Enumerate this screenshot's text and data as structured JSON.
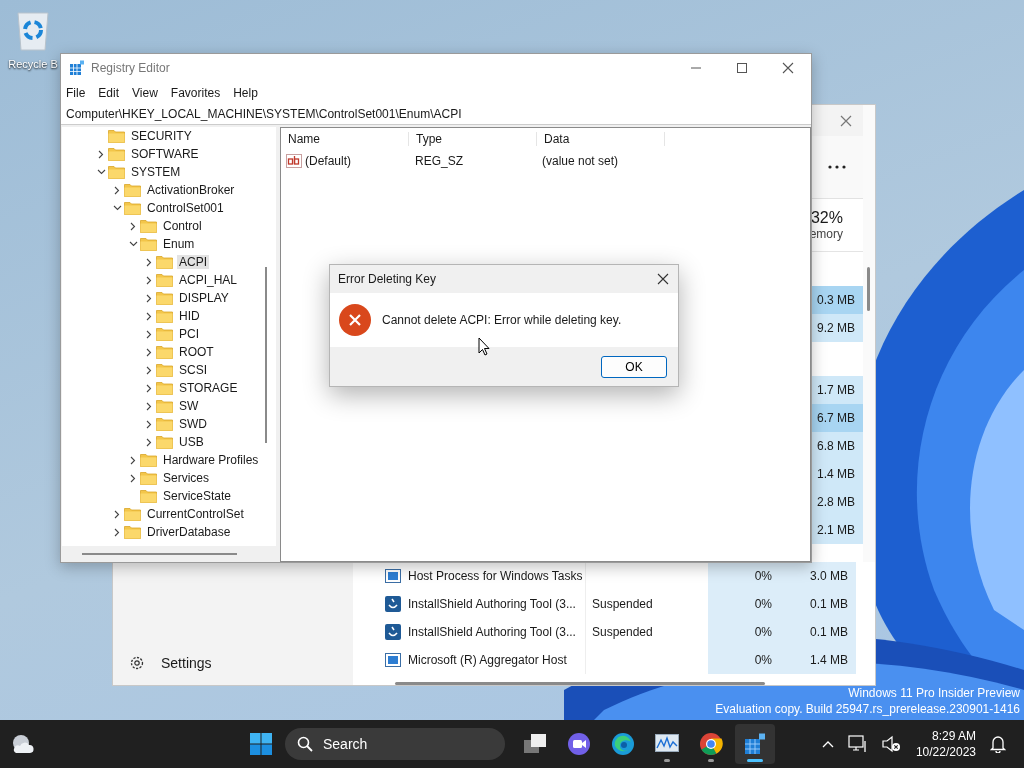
{
  "desktop": {
    "icons": [
      {
        "label": "Recycle B"
      }
    ],
    "watermark": [
      "Windows 11 Pro Insider Preview",
      "Evaluation copy. Build 25947.rs_prerelease.230901-1416"
    ]
  },
  "task_manager": {
    "memory_percent": "32%",
    "memory_label": "emory",
    "memory_rows": [
      {
        "kind": "group"
      },
      {
        "kind": "process",
        "memory": "0.3 MB",
        "color": "#a8d5f2"
      },
      {
        "kind": "process",
        "memory": "9.2 MB",
        "color": "#cfe8f8"
      },
      {
        "kind": "group"
      },
      {
        "kind": "process",
        "memory": "1.7 MB",
        "color": "#cfe8f8"
      },
      {
        "kind": "process",
        "memory": "6.7 MB",
        "color": "#a8d5f2"
      },
      {
        "kind": "process",
        "memory": "6.8 MB",
        "color": "#cfe8f8"
      },
      {
        "kind": "process",
        "memory": "1.4 MB",
        "color": "#cfe8f8"
      },
      {
        "kind": "process",
        "memory": "2.8 MB",
        "color": "#cfe8f8"
      },
      {
        "kind": "process",
        "memory": "2.1 MB",
        "color": "#cfe8f8"
      }
    ],
    "processes": [
      {
        "kind": "window",
        "name": "Host Process for Windows Tasks",
        "cpu": "0%",
        "memory": "3.0 MB"
      },
      {
        "kind": "installer",
        "name": "InstallShield Authoring Tool (3...",
        "status": "Suspended",
        "cpu": "0%",
        "memory": "0.1 MB"
      },
      {
        "kind": "installer",
        "name": "InstallShield Authoring Tool (3...",
        "status": "Suspended",
        "cpu": "0%",
        "memory": "0.1 MB"
      },
      {
        "kind": "window",
        "name": "Microsoft (R) Aggregator Host",
        "cpu": "0%",
        "memory": "1.4 MB"
      }
    ],
    "settings": "Settings"
  },
  "registry": {
    "title": "Registry Editor",
    "menu": [
      "File",
      "Edit",
      "View",
      "Favorites",
      "Help"
    ],
    "address": "Computer\\HKEY_LOCAL_MACHINE\\SYSTEM\\ControlSet001\\Enum\\ACPI",
    "tree": [
      {
        "label": "SECURITY",
        "expandable": false,
        "selected": false
      },
      {
        "label": "SOFTWARE",
        "expandable": true,
        "expanded": false,
        "selected": false
      },
      {
        "label": "SYSTEM",
        "expandable": true,
        "expanded": true,
        "selected": false,
        "children": [
          {
            "label": "ActivationBroker",
            "expandable": true,
            "expanded": false,
            "selected": false
          },
          {
            "label": "ControlSet001",
            "expandable": true,
            "expanded": true,
            "selected": false,
            "children": [
              {
                "label": "Control",
                "expandable": true,
                "expanded": false,
                "selected": false
              },
              {
                "label": "Enum",
                "expandable": true,
                "expanded": true,
                "selected": false,
                "children": [
                  {
                    "label": "ACPI",
                    "expandable": true,
                    "expanded": false,
                    "selected": true
                  },
                  {
                    "label": "ACPI_HAL",
                    "expandable": true,
                    "expanded": false,
                    "selected": false
                  },
                  {
                    "label": "DISPLAY",
                    "expandable": true,
                    "expanded": false,
                    "selected": false
                  },
                  {
                    "label": "HID",
                    "expandable": true,
                    "expanded": false,
                    "selected": false
                  },
                  {
                    "label": "PCI",
                    "expandable": true,
                    "expanded": false,
                    "selected": false
                  },
                  {
                    "label": "ROOT",
                    "expandable": true,
                    "expanded": false,
                    "selected": false
                  },
                  {
                    "label": "SCSI",
                    "expandable": true,
                    "expanded": false,
                    "selected": false
                  },
                  {
                    "label": "STORAGE",
                    "expandable": true,
                    "expanded": false,
                    "selected": false
                  },
                  {
                    "label": "SW",
                    "expandable": true,
                    "expanded": false,
                    "selected": false
                  },
                  {
                    "label": "SWD",
                    "expandable": true,
                    "expanded": false,
                    "selected": false
                  },
                  {
                    "label": "USB",
                    "expandable": true,
                    "expanded": false,
                    "selected": false
                  }
                ]
              },
              {
                "label": "Hardware Profiles",
                "expandable": true,
                "expanded": false,
                "selected": false
              },
              {
                "label": "Services",
                "expandable": true,
                "expanded": false,
                "selected": false
              },
              {
                "label": "ServiceState",
                "expandable": false,
                "selected": false
              }
            ]
          },
          {
            "label": "CurrentControlSet",
            "expandable": true,
            "expanded": false,
            "selected": false
          },
          {
            "label": "DriverDatabase",
            "expandable": true,
            "expanded": false,
            "selected": false
          }
        ]
      }
    ],
    "columns": [
      "Name",
      "Type",
      "Data"
    ],
    "values": [
      {
        "name": "(Default)",
        "type": "REG_SZ",
        "data": "(value not set)"
      }
    ]
  },
  "dialog": {
    "title": "Error Deleting Key",
    "message": "Cannot delete ACPI:  Error while deleting key.",
    "button": "OK"
  },
  "taskbar": {
    "search": "Search",
    "apps": [
      {
        "kind": "task-view",
        "running": false,
        "selected": false
      },
      {
        "kind": "meet",
        "running": false,
        "selected": false
      },
      {
        "kind": "edge",
        "running": false,
        "selected": false
      },
      {
        "kind": "monitor",
        "running": true,
        "selected": false
      },
      {
        "kind": "chrome",
        "running": true,
        "selected": false
      },
      {
        "kind": "regedit",
        "running": true,
        "selected": true
      }
    ],
    "time": "8:29 AM",
    "date": "10/22/2023"
  }
}
